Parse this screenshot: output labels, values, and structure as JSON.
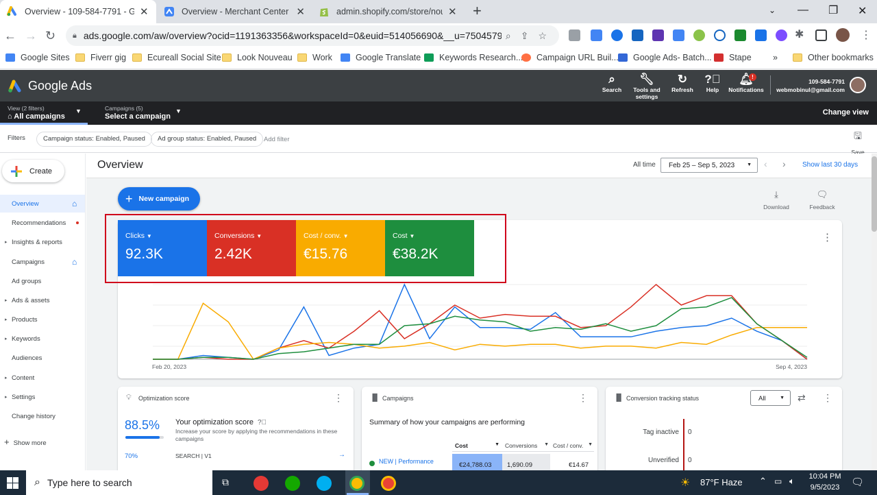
{
  "browser": {
    "tabs": [
      {
        "title": "Overview - 109-584-7791 - Goo",
        "active": true,
        "icon": "google-ads-icon"
      },
      {
        "title": "Overview - Merchant Center",
        "active": false,
        "icon": "merchant-center-icon"
      },
      {
        "title": "admin.shopify.com/store/nouve",
        "active": false,
        "icon": "shopify-icon"
      }
    ],
    "url": "ads.google.com/aw/overview?ocid=1191363356&workspaceId=0&euid=514056690&__u=75045798...",
    "bookmarks": [
      "Google Sites",
      "Fiverr gig",
      "Ecureall Social Site",
      "Look Nouveau",
      "Work",
      "Google Translate",
      "Keywords Research...",
      "Campaign URL Buil...",
      "Google Ads- Batch...",
      "Stape"
    ],
    "other_bookmarks": "Other bookmarks",
    "more": "»"
  },
  "ads_header": {
    "brand": "Google Ads",
    "actions": [
      {
        "label": "Search",
        "icon": "search-icon"
      },
      {
        "label": "Tools and settings",
        "icon": "wrench-icon"
      },
      {
        "label": "Refresh",
        "icon": "refresh-icon"
      },
      {
        "label": "Help",
        "icon": "help-icon"
      },
      {
        "label": "Notifications",
        "icon": "bell-icon",
        "badge": "!"
      }
    ],
    "account_id": "109-584-7791",
    "email": "webmobinul@gmail.com"
  },
  "subheader": {
    "view_label": "View (2 filters)",
    "view_value": "All campaigns",
    "campaigns_label": "Campaigns (5)",
    "campaigns_value": "Select a campaign",
    "change_view": "Change view"
  },
  "filters": {
    "label": "Filters",
    "chips": [
      "Campaign status: Enabled, Paused",
      "Ad group status: Enabled, Paused"
    ],
    "add": "Add filter",
    "save": "Save"
  },
  "sidebar": {
    "create": "Create",
    "items": [
      {
        "label": "Overview",
        "active": true,
        "caret": false,
        "extra": "home"
      },
      {
        "label": "Recommendations",
        "active": false,
        "caret": false,
        "extra": "dot"
      },
      {
        "label": "Insights & reports",
        "active": false,
        "caret": true,
        "extra": ""
      },
      {
        "label": "Campaigns",
        "active": false,
        "caret": false,
        "extra": "home"
      },
      {
        "label": "Ad groups",
        "active": false,
        "caret": false,
        "extra": ""
      },
      {
        "label": "Ads & assets",
        "active": false,
        "caret": true,
        "extra": ""
      },
      {
        "label": "Products",
        "active": false,
        "caret": true,
        "extra": ""
      },
      {
        "label": "Keywords",
        "active": false,
        "caret": true,
        "extra": ""
      },
      {
        "label": "Audiences",
        "active": false,
        "caret": false,
        "extra": ""
      },
      {
        "label": "Content",
        "active": false,
        "caret": true,
        "extra": ""
      },
      {
        "label": "Settings",
        "active": false,
        "caret": true,
        "extra": ""
      },
      {
        "label": "Change history",
        "active": false,
        "caret": false,
        "extra": ""
      }
    ],
    "show_more": "Show more"
  },
  "overview": {
    "title": "Overview",
    "range_label": "All time",
    "date_range": "Feb 25 – Sep 5, 2023",
    "show_last": "Show last 30 days",
    "new_campaign": "New campaign",
    "download": "Download",
    "feedback": "Feedback"
  },
  "metrics": [
    {
      "label": "Clicks",
      "value": "92.3K",
      "color": "#1a73e8"
    },
    {
      "label": "Conversions",
      "value": "2.42K",
      "color": "#d93025"
    },
    {
      "label": "Cost / conv.",
      "value": "€15.76",
      "color": "#f9ab00"
    },
    {
      "label": "Cost",
      "value": "€38.2K",
      "color": "#1e8e3e"
    }
  ],
  "chart_data": {
    "type": "line",
    "x_start": "Feb 20, 2023",
    "x_end": "Sep 4, 2023",
    "grid": true,
    "series": [
      {
        "name": "Clicks",
        "color": "#1a73e8",
        "values": [
          0,
          0,
          2,
          1,
          0,
          5,
          28,
          2,
          6,
          8,
          40,
          11,
          28,
          17,
          17,
          16,
          25,
          12,
          12,
          12,
          15,
          17,
          18,
          22,
          15,
          10,
          0
        ]
      },
      {
        "name": "Conversions",
        "color": "#d93025",
        "values": [
          0,
          0,
          1,
          0,
          0,
          6,
          10,
          6,
          15,
          26,
          11,
          19,
          29,
          22,
          24,
          23,
          23,
          17,
          18,
          28,
          40,
          29,
          34,
          34,
          19,
          10,
          0
        ]
      },
      {
        "name": "Cost / conv.",
        "color": "#f9ab00",
        "values": [
          0,
          0,
          30,
          20,
          0,
          6,
          8,
          9,
          8,
          6,
          7,
          9,
          5,
          8,
          7,
          8,
          8,
          6,
          7,
          7,
          6,
          9,
          8,
          13,
          17,
          17,
          17
        ]
      },
      {
        "name": "Cost",
        "color": "#1e8e3e",
        "values": [
          0,
          0,
          1,
          1,
          0,
          3,
          4,
          6,
          8,
          8,
          18,
          19,
          23,
          21,
          20,
          15,
          17,
          16,
          19,
          15,
          18,
          27,
          28,
          33,
          19,
          10,
          1
        ]
      }
    ]
  },
  "optimization": {
    "title": "Optimization score",
    "score": "88.5%",
    "score_fraction": 0.885,
    "heading": "Your optimization score",
    "desc": "Increase your score by applying the recommendations in these campaigns",
    "row_pct": "70%",
    "row_name": "SEARCH | V1"
  },
  "campaigns_card": {
    "title": "Campaigns",
    "summary": "Summary of how your campaigns are performing",
    "columns": [
      "Cost",
      "Conversions",
      "Cost / conv."
    ],
    "row": {
      "name": "NEW | Performance",
      "cost": "€24,788.03",
      "conversions": "1,690.09",
      "cost_conv": "€14.67"
    }
  },
  "conversion_card": {
    "title": "Conversion tracking status",
    "filter": "All",
    "rows": [
      {
        "label": "Tag inactive",
        "value": "0"
      },
      {
        "label": "Unverified",
        "value": "0"
      }
    ]
  },
  "taskbar": {
    "search": "Type here to search",
    "weather": "87°F  Haze",
    "time": "10:04 PM",
    "date": "9/5/2023"
  }
}
